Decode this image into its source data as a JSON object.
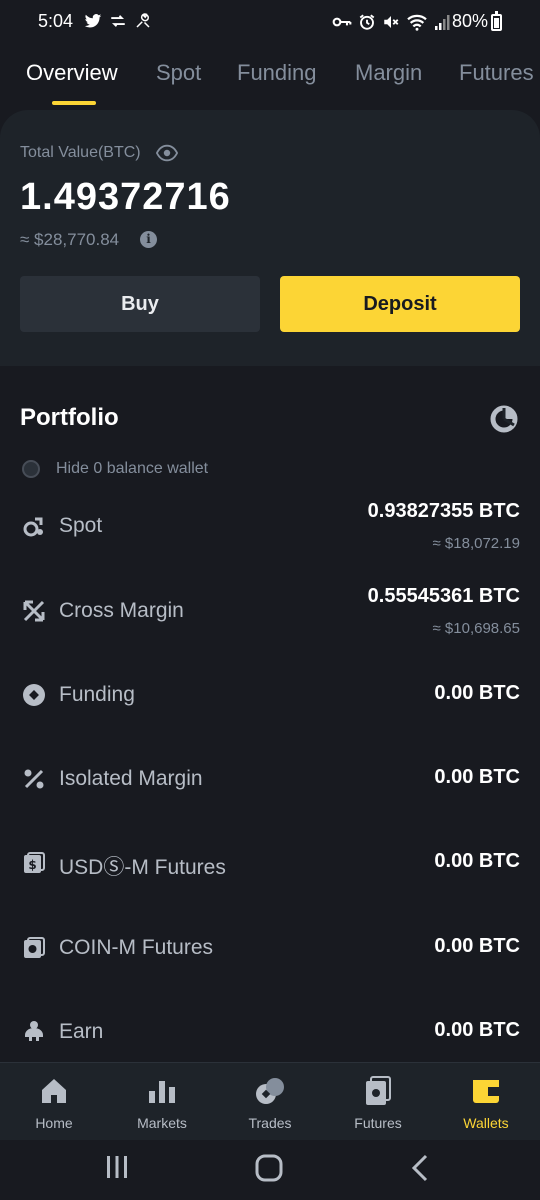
{
  "status_bar": {
    "time": "5:04",
    "battery": "80%",
    "battery_level": 0.8
  },
  "tabs": [
    {
      "label": "Overview",
      "active": true
    },
    {
      "label": "Spot"
    },
    {
      "label": "Funding"
    },
    {
      "label": "Margin"
    },
    {
      "label": "Futures"
    }
  ],
  "balance": {
    "label": "Total Value(BTC)",
    "value": "1.49372716",
    "usd": "≈ $28,770.84",
    "buy_label": "Buy",
    "deposit_label": "Deposit"
  },
  "portfolio": {
    "title": "Portfolio",
    "hide_zero_label": "Hide 0 balance wallet",
    "wallets": [
      {
        "icon": "spot-icon",
        "name": "Spot",
        "btc": "0.93827355 BTC",
        "usd": "≈ $18,072.19"
      },
      {
        "icon": "cross-margin-icon",
        "name": "Cross Margin",
        "btc": "0.55545361 BTC",
        "usd": "≈ $10,698.65"
      },
      {
        "icon": "funding-icon",
        "name": "Funding",
        "btc": "0.00 BTC"
      },
      {
        "icon": "isolated-margin-icon",
        "name": "Isolated Margin",
        "btc": "0.00 BTC"
      },
      {
        "icon": "usds-m-futures-icon",
        "name": "USDⓈ-M Futures",
        "btc": "0.00 BTC"
      },
      {
        "icon": "coin-m-futures-icon",
        "name": "COIN-M Futures",
        "btc": "0.00 BTC"
      },
      {
        "icon": "earn-icon",
        "name": "Earn",
        "btc": "0.00 BTC"
      }
    ]
  },
  "bottom_nav": [
    {
      "label": "Home",
      "icon": "home-icon"
    },
    {
      "label": "Markets",
      "icon": "markets-icon"
    },
    {
      "label": "Trades",
      "icon": "trades-icon"
    },
    {
      "label": "Futures",
      "icon": "futures-icon"
    },
    {
      "label": "Wallets",
      "icon": "wallet-icon",
      "active": true
    }
  ],
  "colors": {
    "accent": "#fcd535",
    "background": "#181a20",
    "card": "#1e2329",
    "muted": "#848e9c"
  }
}
